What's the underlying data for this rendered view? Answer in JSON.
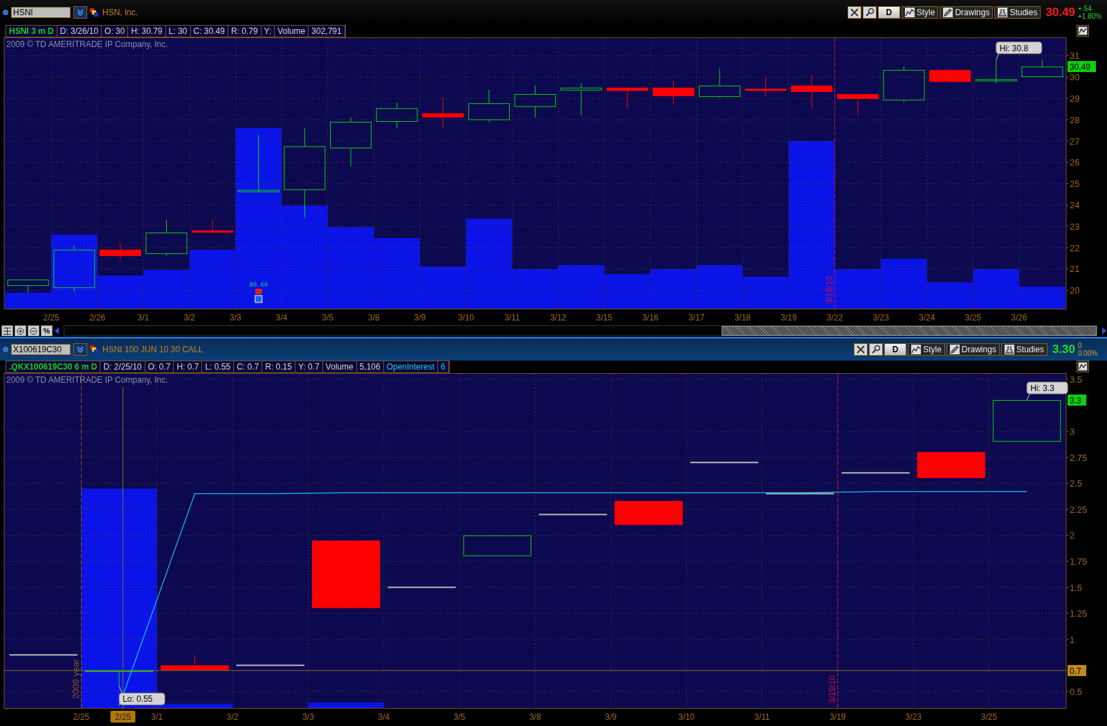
{
  "panels": [
    {
      "symbol_field": {
        "value": "HSNI"
      },
      "company_name": "HSN, Inc.",
      "toolbar": {
        "period_button": "D",
        "style_button": "Style",
        "drawings_button": "Drawings",
        "studies_button": "Studies"
      },
      "last_price": "30.49",
      "last_price_down": true,
      "change": "+.54",
      "change_percent": "+1.80%",
      "change_up": true,
      "change_down": false,
      "info_bar": [
        {
          "kind": "title",
          "text": "HSNI 3 m D"
        },
        {
          "kind": "field",
          "text": "D: 3/26/10"
        },
        {
          "kind": "field",
          "text": "O: 30"
        },
        {
          "kind": "field",
          "text": "H: 30.79"
        },
        {
          "kind": "field",
          "text": "L: 30"
        },
        {
          "kind": "field",
          "text": "C: 30.49"
        },
        {
          "kind": "field",
          "text": "R: 0.79"
        },
        {
          "kind": "field",
          "text": "Y:"
        },
        {
          "kind": "field",
          "text": "Volume"
        },
        {
          "kind": "field",
          "text": "302,791"
        }
      ],
      "chart": {
        "copyright": "2009 © TD AMERITRADE IP Company, Inc.",
        "x_labels": [
          "2/25",
          "2/26",
          "3/1",
          "3/2",
          "3/3",
          "3/4",
          "3/5",
          "3/8",
          "3/9",
          "3/10",
          "3/11",
          "3/12",
          "3/15",
          "3/16",
          "3/17",
          "3/18",
          "3/19",
          "3/22",
          "3/23",
          "3/24",
          "3/25",
          "3/26"
        ],
        "y_labels": [
          "31",
          "30",
          "29",
          "28",
          "27",
          "26",
          "25",
          "24",
          "23",
          "22",
          "21",
          "20"
        ],
        "event_label": "3/19/10",
        "high_callout": "Hi: 30.8",
        "last_marker": "30.49",
        "dividend_label": "$0.68"
      },
      "scroll_bar": {
        "percent_button": "%"
      }
    },
    {
      "symbol_field": {
        "value": "X100619C30"
      },
      "company_name": "HSNI 100 JUN 10 30 CALL",
      "toolbar": {
        "period_button": "D",
        "style_button": "Style",
        "drawings_button": "Drawings",
        "studies_button": "Studies"
      },
      "last_price": "3.30",
      "last_price_down": false,
      "change": "0",
      "change_percent": "0.00%",
      "change_up": false,
      "change_down": false,
      "info_bar": [
        {
          "kind": "title",
          "text": ".QKX100619C30 6 m D"
        },
        {
          "kind": "field",
          "text": "D: 2/25/10"
        },
        {
          "kind": "field",
          "text": "O: 0.7"
        },
        {
          "kind": "field",
          "text": "H: 0.7"
        },
        {
          "kind": "field",
          "text": "L: 0.55"
        },
        {
          "kind": "field",
          "text": "C: 0.7"
        },
        {
          "kind": "field",
          "text": "R: 0.15"
        },
        {
          "kind": "field",
          "text": "Y: 0.7"
        },
        {
          "kind": "field",
          "text": "Volume"
        },
        {
          "kind": "field",
          "text": "5,106"
        },
        {
          "kind": "study",
          "text": "OpenInterest"
        },
        {
          "kind": "study",
          "text": "6"
        }
      ],
      "chart": {
        "copyright": "2009 © TD AMERITRADE IP Company, Inc.",
        "x_labels": [
          "2/25",
          "3/1",
          "3/2",
          "3/3",
          "3/4",
          "3/5",
          "3/8",
          "3/9",
          "3/10",
          "3/11",
          "3/19",
          "3/23",
          "3/25"
        ],
        "y_labels": [
          "3.5",
          "3",
          "2.75",
          "2.5",
          "2.25",
          "2",
          "1.75",
          "1.5",
          "1.25",
          "1",
          "0.5"
        ],
        "event_label": "3/19/10",
        "year_label": "2009 year",
        "cursor_date": "2/25",
        "high_callout": "Hi: 3.3",
        "low_callout": "Lo: 0.55",
        "last_marker": "3.3",
        "cursor_price": "0.7"
      }
    }
  ]
}
